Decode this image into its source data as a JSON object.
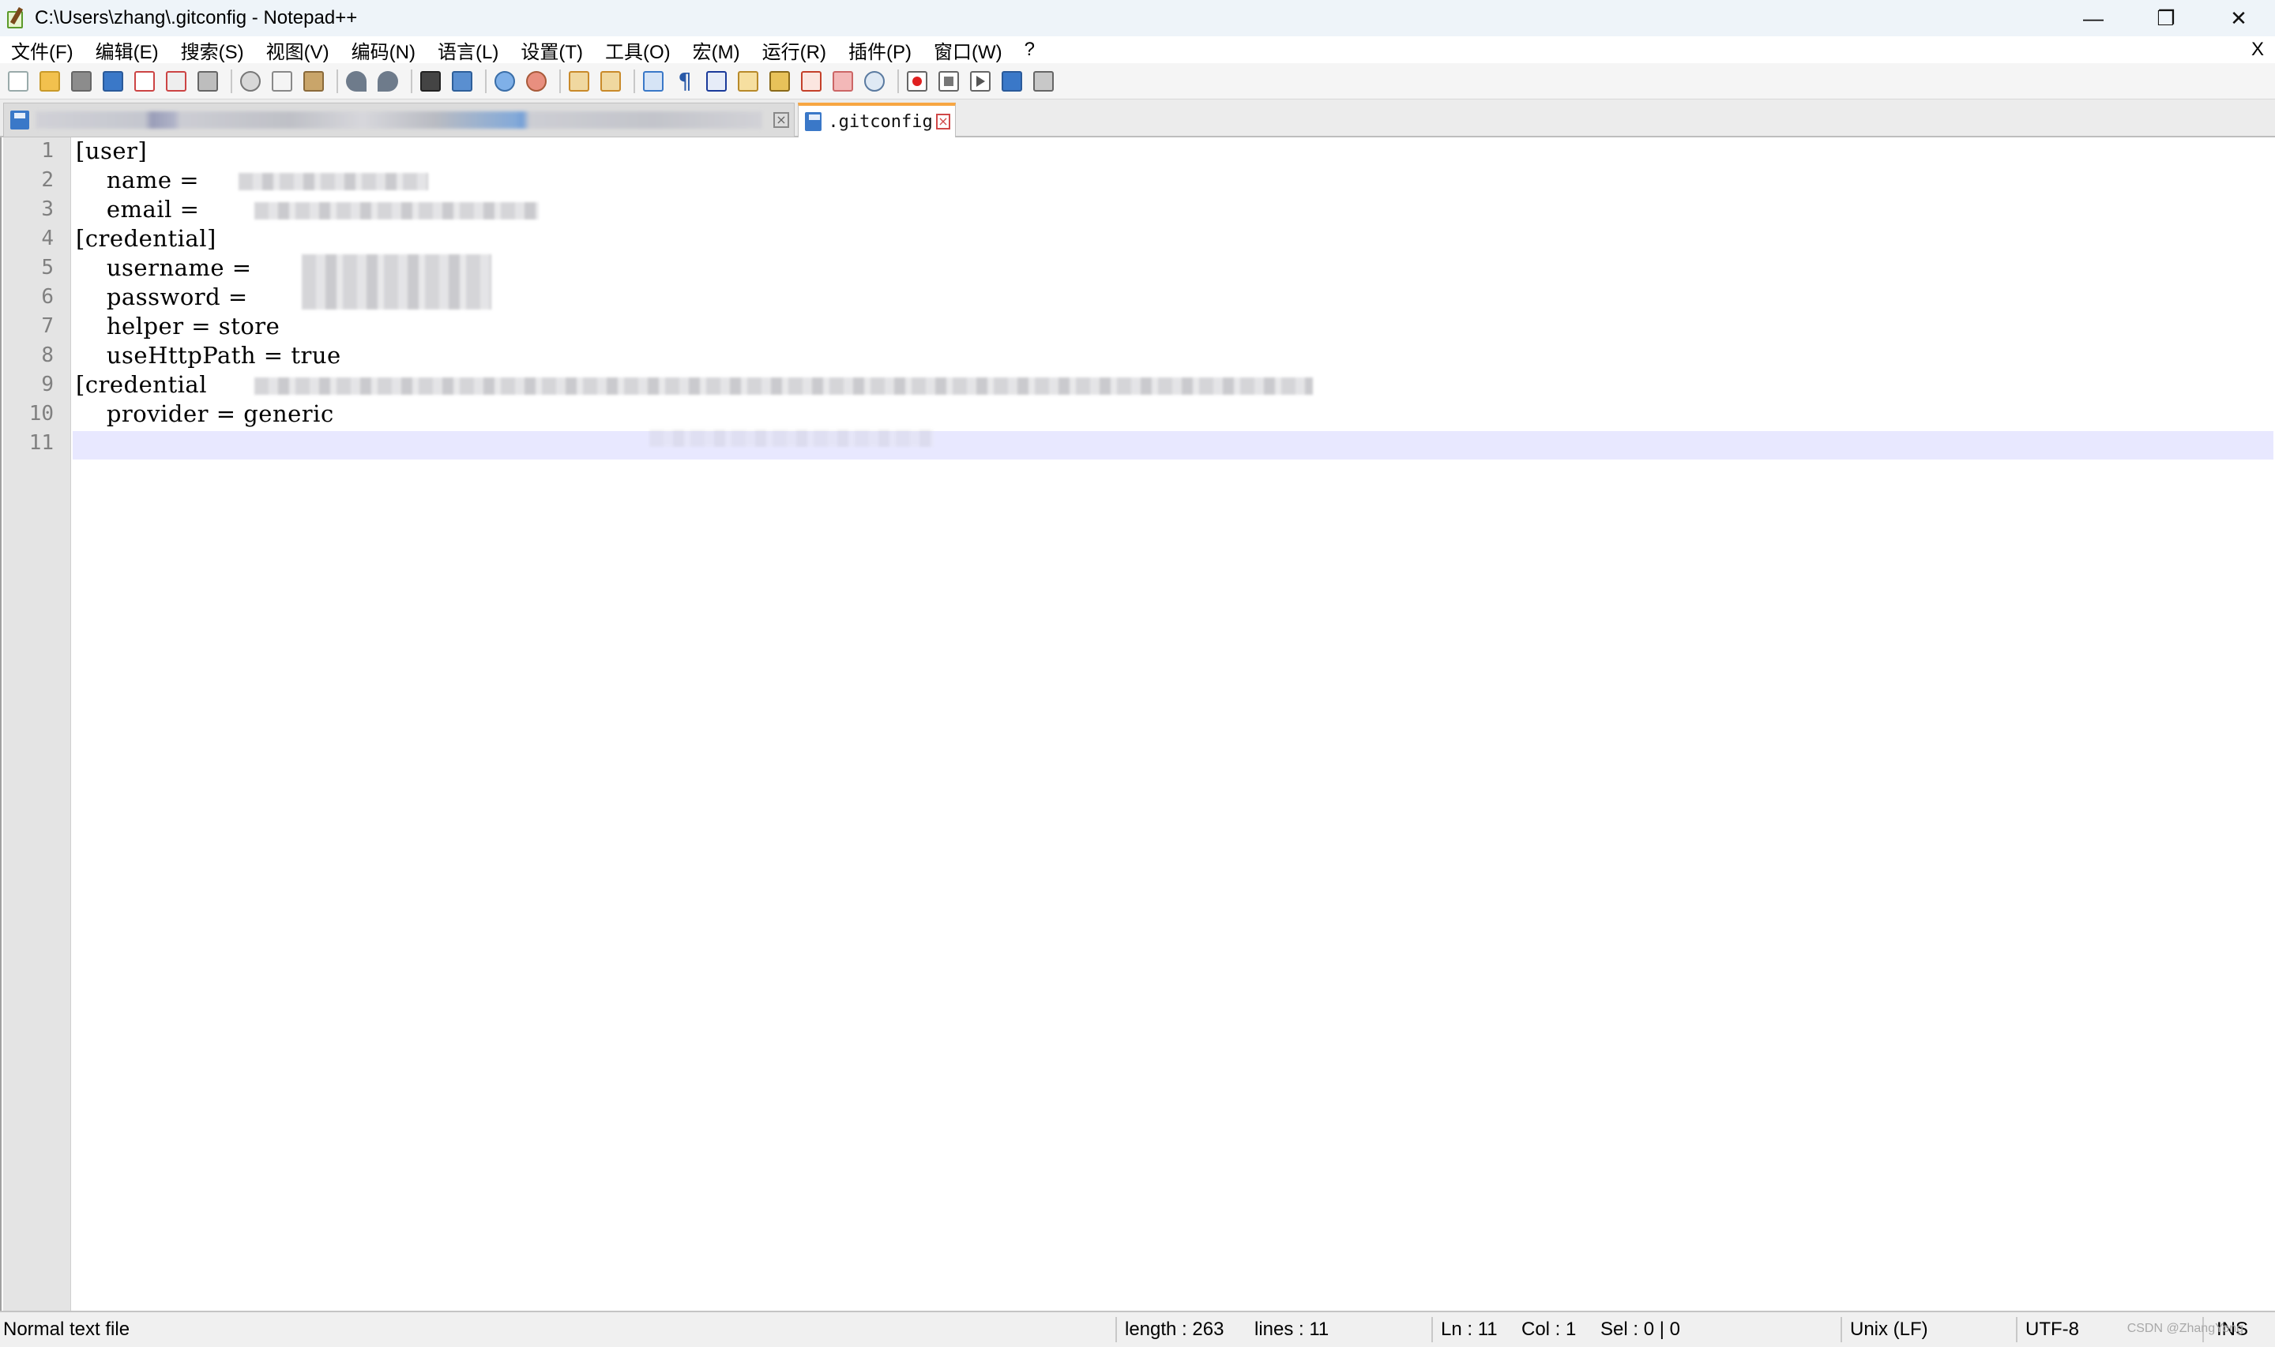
{
  "window": {
    "title": "C:\\Users\\zhang\\.gitconfig - Notepad++",
    "controls": {
      "minimize": "—",
      "restore": "❐",
      "close": "✕"
    }
  },
  "menu": {
    "items": [
      "文件(F)",
      "编辑(E)",
      "搜索(S)",
      "视图(V)",
      "编码(N)",
      "语言(L)",
      "设置(T)",
      "工具(O)",
      "宏(M)",
      "运行(R)",
      "插件(P)",
      "窗口(W)",
      "?"
    ],
    "close_label": "X"
  },
  "toolbar": {
    "icons": [
      "new-file-icon",
      "open-file-icon",
      "save-icon",
      "save-all-icon",
      "close-icon",
      "close-all-icon",
      "print-icon",
      "cut-icon",
      "copy-icon",
      "paste-icon",
      "undo-icon",
      "redo-icon",
      "find-icon",
      "replace-icon",
      "zoom-in-icon",
      "zoom-out-icon",
      "sync-vertical-icon",
      "sync-horizontal-icon",
      "word-wrap-icon",
      "show-all-chars-icon",
      "indent-guide-icon",
      "function-list-icon",
      "document-map-icon",
      "folder-workspace-icon",
      "monitoring-icon",
      "record-macro-icon",
      "stop-macro-icon",
      "play-macro-icon",
      "run-macro-multiple-icon",
      "save-macro-icon"
    ],
    "paragraph_glyph": "¶"
  },
  "tabs": [
    {
      "label": "",
      "active": false
    },
    {
      "label": ".gitconfig",
      "active": true
    }
  ],
  "editor": {
    "line_numbers": [
      "1",
      "2",
      "3",
      "4",
      "5",
      "6",
      "7",
      "8",
      "9",
      "10",
      "11"
    ],
    "lines": [
      "[user]",
      "    name = ",
      "    email = ",
      "[credential]",
      "    username = ",
      "    password = ",
      "    helper = store",
      "    useHttpPath = true",
      "[credential ",
      "    provider = generic",
      ""
    ],
    "current_line": 11
  },
  "status": {
    "file_type": "Normal text file",
    "length": "length : 263",
    "lines": "lines : 11",
    "ln": "Ln : 11",
    "col": "Col : 1",
    "sel": "Sel : 0 | 0",
    "eol": "Unix (LF)",
    "encoding": "UTF-8",
    "mode": "INS",
    "watermark": "CSDN @ZhangYong"
  }
}
